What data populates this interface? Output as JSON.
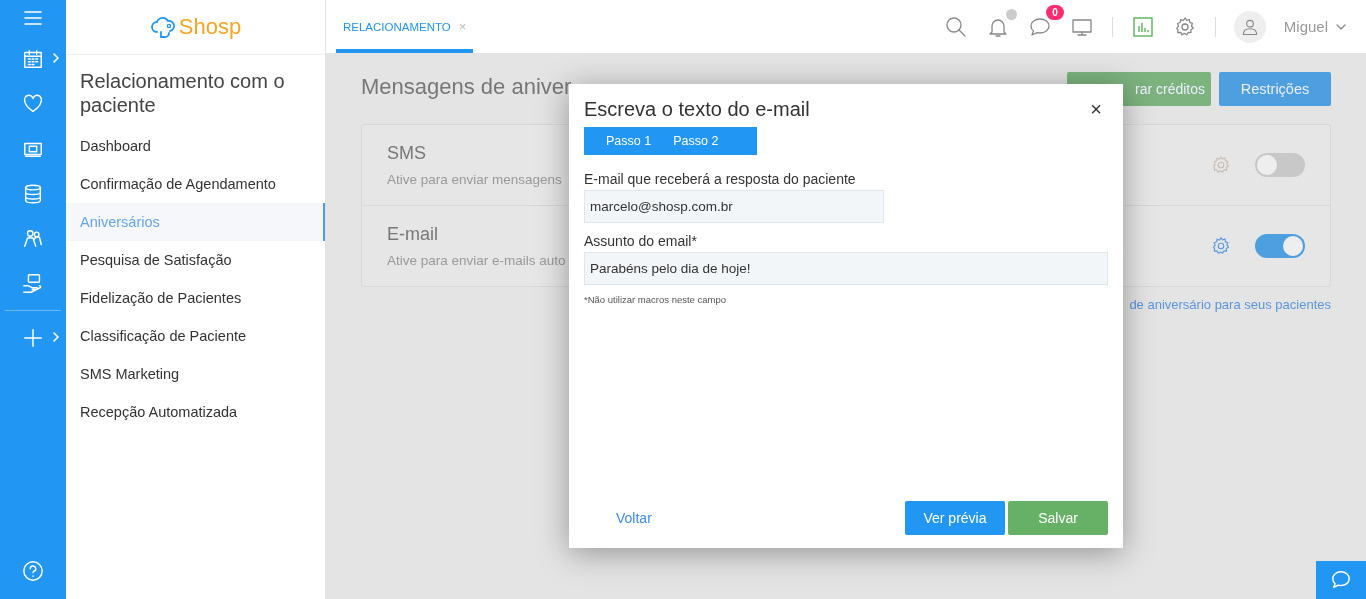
{
  "rail": {
    "items": [
      {
        "kind": "calendar",
        "submenu": true
      },
      {
        "kind": "heart",
        "submenu": false
      },
      {
        "kind": "money",
        "submenu": false
      },
      {
        "kind": "database",
        "submenu": false
      },
      {
        "kind": "people",
        "submenu": false
      },
      {
        "kind": "care",
        "submenu": false
      },
      {
        "kind": "plus",
        "submenu": true
      }
    ]
  },
  "logo": {
    "text": "Shosp"
  },
  "sidebar": {
    "title": "Relacionamento com o paciente",
    "items": [
      {
        "label": "Dashboard",
        "selected": false
      },
      {
        "label": "Confirmação de Agendamento",
        "selected": false
      },
      {
        "label": "Aniversários",
        "selected": true
      },
      {
        "label": "Pesquisa de Satisfação",
        "selected": false
      },
      {
        "label": "Fidelização de Pacientes",
        "selected": false
      },
      {
        "label": "Classificação de Paciente",
        "selected": false
      },
      {
        "label": "SMS Marketing",
        "selected": false
      },
      {
        "label": "Recepção Automatizada",
        "selected": false
      }
    ]
  },
  "tabs": [
    {
      "label": "RELACIONAMENTO",
      "close": "×",
      "selected": true
    }
  ],
  "header": {
    "chat_badge": "0",
    "user": "Miguel"
  },
  "page": {
    "title": "Mensagens de aniver",
    "buttons": [
      {
        "label": "rar créditos",
        "kind": "green"
      },
      {
        "label": "Restrições",
        "kind": "blue"
      }
    ],
    "channels": [
      {
        "name": "SMS",
        "description": "Ative para enviar mensagens",
        "on": false
      },
      {
        "name": "E-mail",
        "description": "Ative para enviar e-mails auto",
        "on": true
      }
    ],
    "link": "de aniversário para seus pacientes"
  },
  "dialog": {
    "title": "Escreva o texto do e-mail",
    "close": "×",
    "steps": [
      {
        "label": "Passo 1"
      },
      {
        "label": "Passo 2"
      }
    ],
    "fields": [
      {
        "label": "E-mail que receberá a resposta do paciente",
        "value": "marcelo@shosp.com.br"
      },
      {
        "label": "Assunto do email*",
        "value": "Parabéns pelo dia de hoje!"
      }
    ],
    "note": "*Não utilizar macros neste campo",
    "back": "Voltar",
    "buttons": [
      {
        "label": "Ver prévia",
        "kind": "blue"
      },
      {
        "label": "Salvar",
        "kind": "green"
      }
    ]
  }
}
